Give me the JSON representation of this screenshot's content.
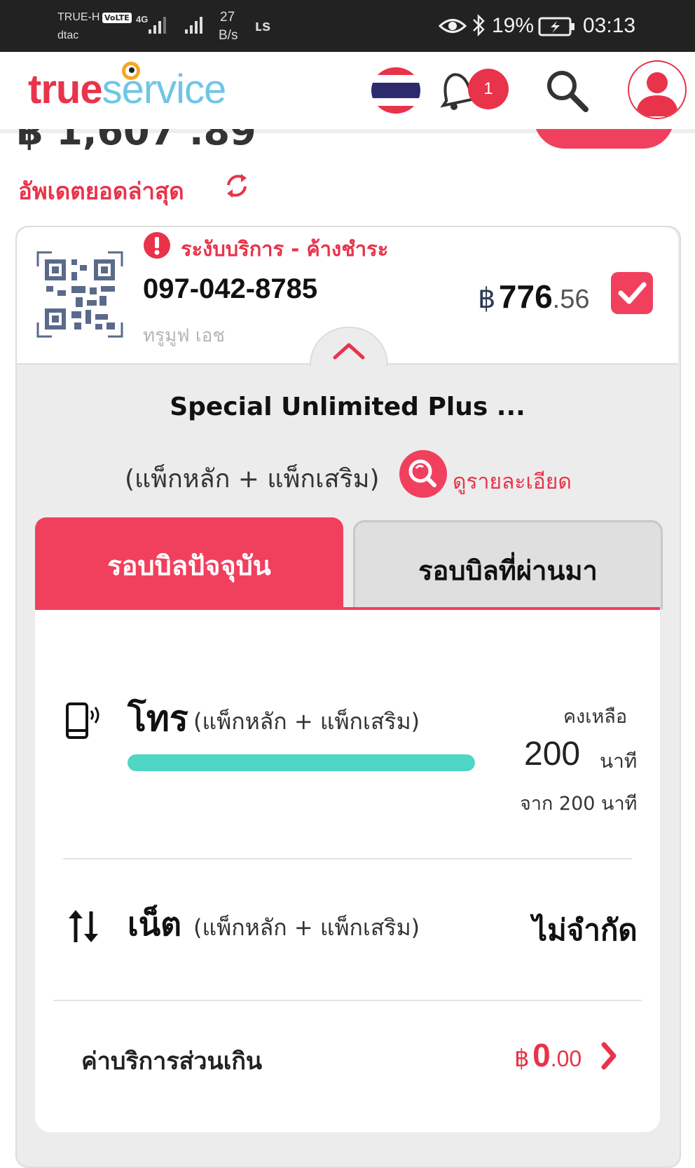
{
  "status_bar": {
    "carrier1": "TRUE-H",
    "volte": "VoLTE",
    "net_type": "4G",
    "carrier2": "dtac",
    "speed_value": "27",
    "speed_unit": "B/s",
    "extra": "ʟs",
    "battery": "19%",
    "time": "03:13"
  },
  "header": {
    "logo_part1": "true",
    "logo_part2": "service",
    "notification_count": "1"
  },
  "summary": {
    "total_amount": "฿ 1,607 .89",
    "update_label": "อัพเดตยอดล่าสุด"
  },
  "account": {
    "status_text": "ระงับบริการ  -  ค้างชำระ",
    "phone_number": "097-042-8785",
    "plan_type": "ทรูมูฟ เอช",
    "amount_currency": "฿",
    "amount_main": "776",
    "amount_decimal": ".56"
  },
  "package": {
    "name": "Special  Unlimited  Plus  ...",
    "subtitle": "(แพ็กหลัก  +  แพ็กเสริม)",
    "detail_link": "ดูรายละเอียด"
  },
  "tabs": {
    "current": "รอบบิลปัจจุบัน",
    "past": "รอบบิลที่ผ่านมา"
  },
  "call": {
    "label": "โทร",
    "sub": "(แพ็กหลัก  +  แพ็กเสริม)",
    "remaining_label": "คงเหลือ",
    "remaining_value": "200",
    "remaining_unit": "นาที",
    "total_text": "จาก 200 นาที",
    "progress": 1.0
  },
  "net": {
    "label": "เน็ต",
    "sub": "(แพ็กหลัก  +  แพ็กเสริม)",
    "value": "ไม่จำกัด"
  },
  "overage": {
    "label": "ค่าบริการส่วนเกิน",
    "currency": "฿",
    "amount_main": "0",
    "amount_decimal": ".00"
  },
  "colors": {
    "brand": "#e8334a",
    "progress": "#4fd6c4"
  }
}
